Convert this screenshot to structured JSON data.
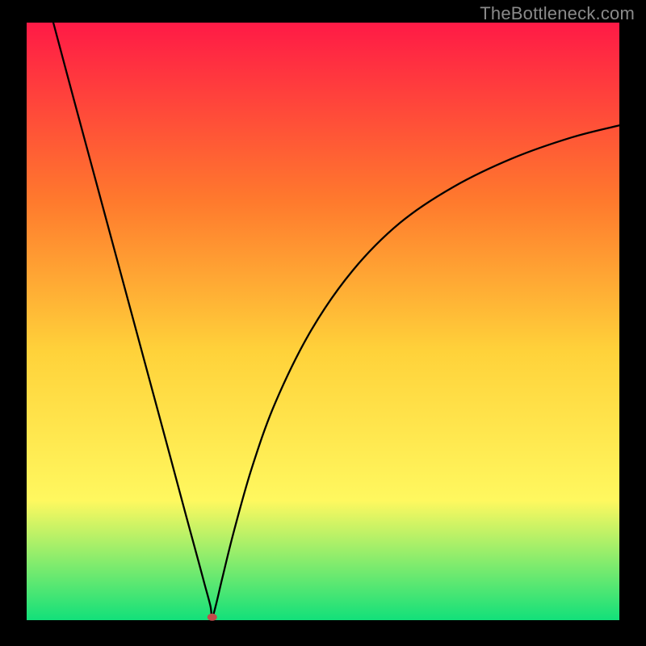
{
  "watermark": "TheBottleneck.com",
  "chart_data": {
    "type": "line",
    "title": "",
    "xlabel": "",
    "ylabel": "",
    "xlim": [
      0,
      100
    ],
    "ylim": [
      0,
      100
    ],
    "grid": false,
    "legend": false,
    "background_gradient": {
      "top_color": "#ff1a46",
      "mid_top_color": "#ff7a2d",
      "mid_color": "#ffd23a",
      "mid_bottom_color": "#fff85f",
      "bottom_color": "#12e07a"
    },
    "curve_color": "#000000",
    "curve_stroke": 2.3,
    "minimum_point": {
      "x": 31.3,
      "y": 0.5
    },
    "minimum_marker": {
      "color": "#c24a4a",
      "rx": 6,
      "ry": 4.5
    },
    "series": [
      {
        "name": "bottleneck-curve",
        "description": "V-shaped curve: steep near-linear left descent, flat minimum around x≈31, asymptotic rise on right",
        "x": [
          4.5,
          8,
          12,
          16,
          20,
          24,
          27,
          29,
          30,
          31,
          31.3,
          32,
          33,
          35,
          38,
          42,
          48,
          55,
          63,
          72,
          82,
          92,
          100
        ],
        "y": [
          100,
          87,
          72.3,
          57.6,
          42.9,
          28.2,
          17.1,
          9.8,
          6.1,
          2.4,
          0.5,
          2.8,
          7.0,
          15.0,
          25.5,
          36.5,
          48.5,
          58.5,
          66.5,
          72.5,
          77.3,
          80.8,
          82.8
        ]
      }
    ]
  }
}
